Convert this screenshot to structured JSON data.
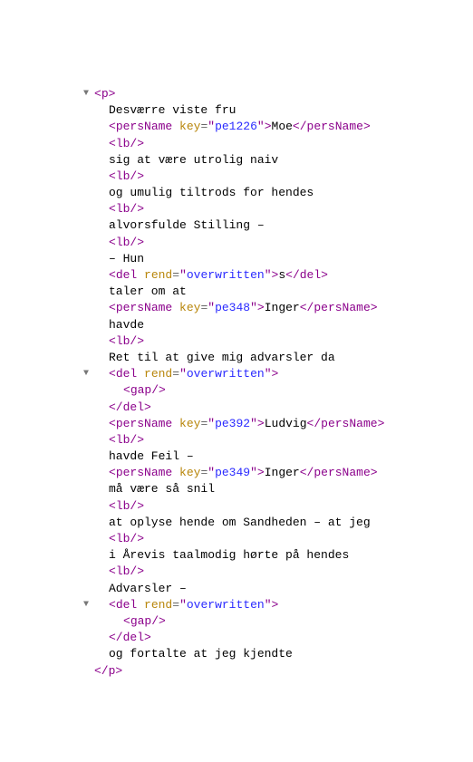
{
  "lines": [
    {
      "indent": 0,
      "twisty": true,
      "parts": [
        {
          "k": "punct",
          "t": "<"
        },
        {
          "k": "tag",
          "t": "p"
        },
        {
          "k": "punct",
          "t": ">"
        }
      ]
    },
    {
      "indent": 1,
      "parts": [
        {
          "k": "txt",
          "t": "Desværre viste fru"
        }
      ]
    },
    {
      "indent": 1,
      "parts": [
        {
          "k": "punct",
          "t": "<"
        },
        {
          "k": "tag",
          "t": "persName"
        },
        {
          "k": "txt",
          "t": " "
        },
        {
          "k": "attr",
          "t": "key"
        },
        {
          "k": "eq",
          "t": "="
        },
        {
          "k": "punct",
          "t": "\""
        },
        {
          "k": "val",
          "t": "pe1226"
        },
        {
          "k": "punct",
          "t": "\""
        },
        {
          "k": "punct",
          "t": ">"
        },
        {
          "k": "txt",
          "t": "Moe"
        },
        {
          "k": "punct",
          "t": "</"
        },
        {
          "k": "tag",
          "t": "persName"
        },
        {
          "k": "punct",
          "t": ">"
        }
      ]
    },
    {
      "indent": 1,
      "parts": [
        {
          "k": "punct",
          "t": "<"
        },
        {
          "k": "tag",
          "t": "lb"
        },
        {
          "k": "punct",
          "t": "/>"
        }
      ]
    },
    {
      "indent": 1,
      "parts": [
        {
          "k": "txt",
          "t": "sig at være utrolig naiv"
        }
      ]
    },
    {
      "indent": 1,
      "parts": [
        {
          "k": "punct",
          "t": "<"
        },
        {
          "k": "tag",
          "t": "lb"
        },
        {
          "k": "punct",
          "t": "/>"
        }
      ]
    },
    {
      "indent": 1,
      "parts": [
        {
          "k": "txt",
          "t": "og umulig tiltrods for hendes"
        }
      ]
    },
    {
      "indent": 1,
      "parts": [
        {
          "k": "punct",
          "t": "<"
        },
        {
          "k": "tag",
          "t": "lb"
        },
        {
          "k": "punct",
          "t": "/>"
        }
      ]
    },
    {
      "indent": 1,
      "parts": [
        {
          "k": "txt",
          "t": "alvorsfulde Stilling –"
        }
      ]
    },
    {
      "indent": 1,
      "parts": [
        {
          "k": "punct",
          "t": "<"
        },
        {
          "k": "tag",
          "t": "lb"
        },
        {
          "k": "punct",
          "t": "/>"
        }
      ]
    },
    {
      "indent": 1,
      "parts": [
        {
          "k": "txt",
          "t": "– Hun"
        }
      ]
    },
    {
      "indent": 1,
      "parts": [
        {
          "k": "punct",
          "t": "<"
        },
        {
          "k": "tag",
          "t": "del"
        },
        {
          "k": "txt",
          "t": " "
        },
        {
          "k": "attr",
          "t": "rend"
        },
        {
          "k": "eq",
          "t": "="
        },
        {
          "k": "punct",
          "t": "\""
        },
        {
          "k": "val",
          "t": "overwritten"
        },
        {
          "k": "punct",
          "t": "\""
        },
        {
          "k": "punct",
          "t": ">"
        },
        {
          "k": "txt",
          "t": "s"
        },
        {
          "k": "punct",
          "t": "</"
        },
        {
          "k": "tag",
          "t": "del"
        },
        {
          "k": "punct",
          "t": ">"
        }
      ]
    },
    {
      "indent": 1,
      "parts": [
        {
          "k": "txt",
          "t": "taler om at"
        }
      ]
    },
    {
      "indent": 1,
      "parts": [
        {
          "k": "punct",
          "t": "<"
        },
        {
          "k": "tag",
          "t": "persName"
        },
        {
          "k": "txt",
          "t": " "
        },
        {
          "k": "attr",
          "t": "key"
        },
        {
          "k": "eq",
          "t": "="
        },
        {
          "k": "punct",
          "t": "\""
        },
        {
          "k": "val",
          "t": "pe348"
        },
        {
          "k": "punct",
          "t": "\""
        },
        {
          "k": "punct",
          "t": ">"
        },
        {
          "k": "txt",
          "t": "Inger"
        },
        {
          "k": "punct",
          "t": "</"
        },
        {
          "k": "tag",
          "t": "persName"
        },
        {
          "k": "punct",
          "t": ">"
        }
      ]
    },
    {
      "indent": 1,
      "parts": [
        {
          "k": "txt",
          "t": "havde"
        }
      ]
    },
    {
      "indent": 1,
      "parts": [
        {
          "k": "punct",
          "t": "<"
        },
        {
          "k": "tag",
          "t": "lb"
        },
        {
          "k": "punct",
          "t": "/>"
        }
      ]
    },
    {
      "indent": 1,
      "parts": [
        {
          "k": "txt",
          "t": "Ret til at give mig advarsler da"
        }
      ]
    },
    {
      "indent": 1,
      "twisty": true,
      "parts": [
        {
          "k": "punct",
          "t": "<"
        },
        {
          "k": "tag",
          "t": "del"
        },
        {
          "k": "txt",
          "t": " "
        },
        {
          "k": "attr",
          "t": "rend"
        },
        {
          "k": "eq",
          "t": "="
        },
        {
          "k": "punct",
          "t": "\""
        },
        {
          "k": "val",
          "t": "overwritten"
        },
        {
          "k": "punct",
          "t": "\""
        },
        {
          "k": "punct",
          "t": ">"
        }
      ]
    },
    {
      "indent": 2,
      "parts": [
        {
          "k": "punct",
          "t": "<"
        },
        {
          "k": "tag",
          "t": "gap"
        },
        {
          "k": "punct",
          "t": "/>"
        }
      ]
    },
    {
      "indent": 1,
      "parts": [
        {
          "k": "punct",
          "t": "</"
        },
        {
          "k": "tag",
          "t": "del"
        },
        {
          "k": "punct",
          "t": ">"
        }
      ]
    },
    {
      "indent": 1,
      "parts": [
        {
          "k": "punct",
          "t": "<"
        },
        {
          "k": "tag",
          "t": "persName"
        },
        {
          "k": "txt",
          "t": " "
        },
        {
          "k": "attr",
          "t": "key"
        },
        {
          "k": "eq",
          "t": "="
        },
        {
          "k": "punct",
          "t": "\""
        },
        {
          "k": "val",
          "t": "pe392"
        },
        {
          "k": "punct",
          "t": "\""
        },
        {
          "k": "punct",
          "t": ">"
        },
        {
          "k": "txt",
          "t": "Ludvig"
        },
        {
          "k": "punct",
          "t": "</"
        },
        {
          "k": "tag",
          "t": "persName"
        },
        {
          "k": "punct",
          "t": ">"
        }
      ]
    },
    {
      "indent": 1,
      "parts": [
        {
          "k": "punct",
          "t": "<"
        },
        {
          "k": "tag",
          "t": "lb"
        },
        {
          "k": "punct",
          "t": "/>"
        }
      ]
    },
    {
      "indent": 1,
      "parts": [
        {
          "k": "txt",
          "t": "havde Feil –"
        }
      ]
    },
    {
      "indent": 1,
      "parts": [
        {
          "k": "punct",
          "t": "<"
        },
        {
          "k": "tag",
          "t": "persName"
        },
        {
          "k": "txt",
          "t": " "
        },
        {
          "k": "attr",
          "t": "key"
        },
        {
          "k": "eq",
          "t": "="
        },
        {
          "k": "punct",
          "t": "\""
        },
        {
          "k": "val",
          "t": "pe349"
        },
        {
          "k": "punct",
          "t": "\""
        },
        {
          "k": "punct",
          "t": ">"
        },
        {
          "k": "txt",
          "t": "Inger"
        },
        {
          "k": "punct",
          "t": "</"
        },
        {
          "k": "tag",
          "t": "persName"
        },
        {
          "k": "punct",
          "t": ">"
        }
      ]
    },
    {
      "indent": 1,
      "parts": [
        {
          "k": "txt",
          "t": "må være så snil"
        }
      ]
    },
    {
      "indent": 1,
      "parts": [
        {
          "k": "punct",
          "t": "<"
        },
        {
          "k": "tag",
          "t": "lb"
        },
        {
          "k": "punct",
          "t": "/>"
        }
      ]
    },
    {
      "indent": 1,
      "parts": [
        {
          "k": "txt",
          "t": "at oplyse hende om Sandheden – at jeg"
        }
      ]
    },
    {
      "indent": 1,
      "parts": [
        {
          "k": "punct",
          "t": "<"
        },
        {
          "k": "tag",
          "t": "lb"
        },
        {
          "k": "punct",
          "t": "/>"
        }
      ]
    },
    {
      "indent": 1,
      "parts": [
        {
          "k": "txt",
          "t": "i Årevis taalmodig hørte på hendes"
        }
      ]
    },
    {
      "indent": 1,
      "parts": [
        {
          "k": "punct",
          "t": "<"
        },
        {
          "k": "tag",
          "t": "lb"
        },
        {
          "k": "punct",
          "t": "/>"
        }
      ]
    },
    {
      "indent": 1,
      "parts": [
        {
          "k": "txt",
          "t": "Advarsler –"
        }
      ]
    },
    {
      "indent": 1,
      "twisty": true,
      "parts": [
        {
          "k": "punct",
          "t": "<"
        },
        {
          "k": "tag",
          "t": "del"
        },
        {
          "k": "txt",
          "t": " "
        },
        {
          "k": "attr",
          "t": "rend"
        },
        {
          "k": "eq",
          "t": "="
        },
        {
          "k": "punct",
          "t": "\""
        },
        {
          "k": "val",
          "t": "overwritten"
        },
        {
          "k": "punct",
          "t": "\""
        },
        {
          "k": "punct",
          "t": ">"
        }
      ]
    },
    {
      "indent": 2,
      "parts": [
        {
          "k": "punct",
          "t": "<"
        },
        {
          "k": "tag",
          "t": "gap"
        },
        {
          "k": "punct",
          "t": "/>"
        }
      ]
    },
    {
      "indent": 1,
      "parts": [
        {
          "k": "punct",
          "t": "</"
        },
        {
          "k": "tag",
          "t": "del"
        },
        {
          "k": "punct",
          "t": ">"
        }
      ]
    },
    {
      "indent": 1,
      "parts": [
        {
          "k": "txt",
          "t": "og fortalte at jeg kjendte"
        }
      ]
    },
    {
      "indent": 0,
      "parts": [
        {
          "k": "punct",
          "t": "</"
        },
        {
          "k": "tag",
          "t": "p"
        },
        {
          "k": "punct",
          "t": ">"
        }
      ]
    }
  ]
}
